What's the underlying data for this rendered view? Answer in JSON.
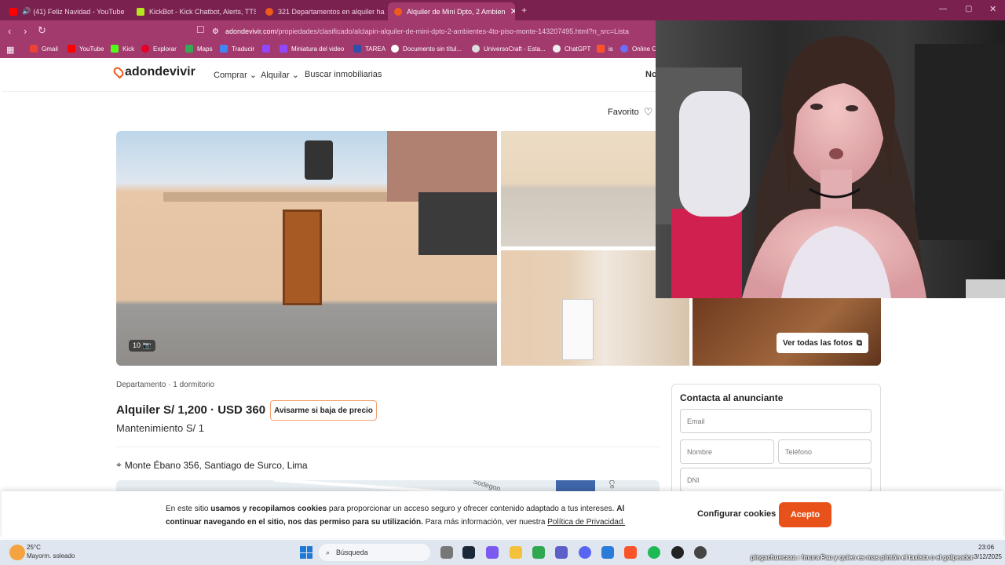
{
  "browser": {
    "tabs": [
      {
        "label": "(41) Feliz Navidad - YouTube",
        "icon": "youtube-icon",
        "active": false
      },
      {
        "label": "KickBot - Kick Chatbot, Alerts, TTS, C",
        "icon": "kickbot-icon",
        "active": false
      },
      {
        "label": "321 Departamentos en alquiler hasta",
        "icon": "adondevivir-icon",
        "active": false
      },
      {
        "label": "Alquiler de Mini Dpto, 2 Ambien",
        "icon": "adondevivir-icon",
        "active": true
      }
    ],
    "new_tab": "+",
    "url_domain": "adondevivir.com",
    "url_path": "/propiedades/clasificado/alclapin-alquiler-de-mini-dpto-2-ambientes-4to-piso-monte-143207495.html?n_src=Lista",
    "bookmarks": [
      "Gmail",
      "YouTube",
      "Kick",
      "Explorar",
      "Maps",
      "Traducir",
      "",
      "Miniatura del video",
      "TAREA",
      "Documento sin títul...",
      "UniversoCraft - Esta...",
      "ChatGPT",
      "is",
      "Online C"
    ]
  },
  "site": {
    "logo": "adondevivir",
    "nav": [
      "Comprar",
      "Alquilar",
      "Buscar inmobiliarias"
    ],
    "header_right": "No",
    "favorite_label": "Favorito",
    "photo_count": "10",
    "all_photos_button": "Ver todas las fotos",
    "property_type": "Departamento · 1 dormitorio",
    "price": "Alquiler S/ 1,200 · USD 360",
    "price_alert_button": "Avisarme si baja de precio",
    "maintenance": "Mantenimiento S/ 1",
    "address": "Monte Ébano 356, Santiago de Surco, Lima",
    "map_labels": [
      "Sodegon",
      "Ce"
    ],
    "contact": {
      "title": "Contacta al anunciante",
      "email_placeholder": "Email",
      "name_placeholder": "Nombre",
      "phone_placeholder": "Teléfono",
      "dni_placeholder": "DNI"
    }
  },
  "cookie_banner": {
    "text_1": "En este sitio ",
    "bold_1": "usamos y recopilamos cookies",
    "text_2": " para proporcionar un acceso seguro y ofrecer contenido adaptado a tus intereses. ",
    "bold_2": "Al continuar navegando en el sitio, nos das permiso para su utilización.",
    "text_3": " Para más información, ver nuestra ",
    "link": "Política de Privacidad.",
    "configure_button": "Configurar cookies",
    "accept_button": "Acepto"
  },
  "taskbar": {
    "weather_temp": "25°C",
    "weather_desc": "Mayorm. soleado",
    "search_placeholder": "Búsqueda",
    "chat_overlay": "pingachuecaaa : !mura Pau y quien es mas pintón el taxista o el golpeador",
    "time": "23:06",
    "date": "3/12/2025"
  },
  "colors": {
    "browser_frame": "#a23a6e",
    "tab_bar": "#7a2150",
    "brand_orange": "#f05a1a",
    "accept_button": "#e8521a"
  }
}
